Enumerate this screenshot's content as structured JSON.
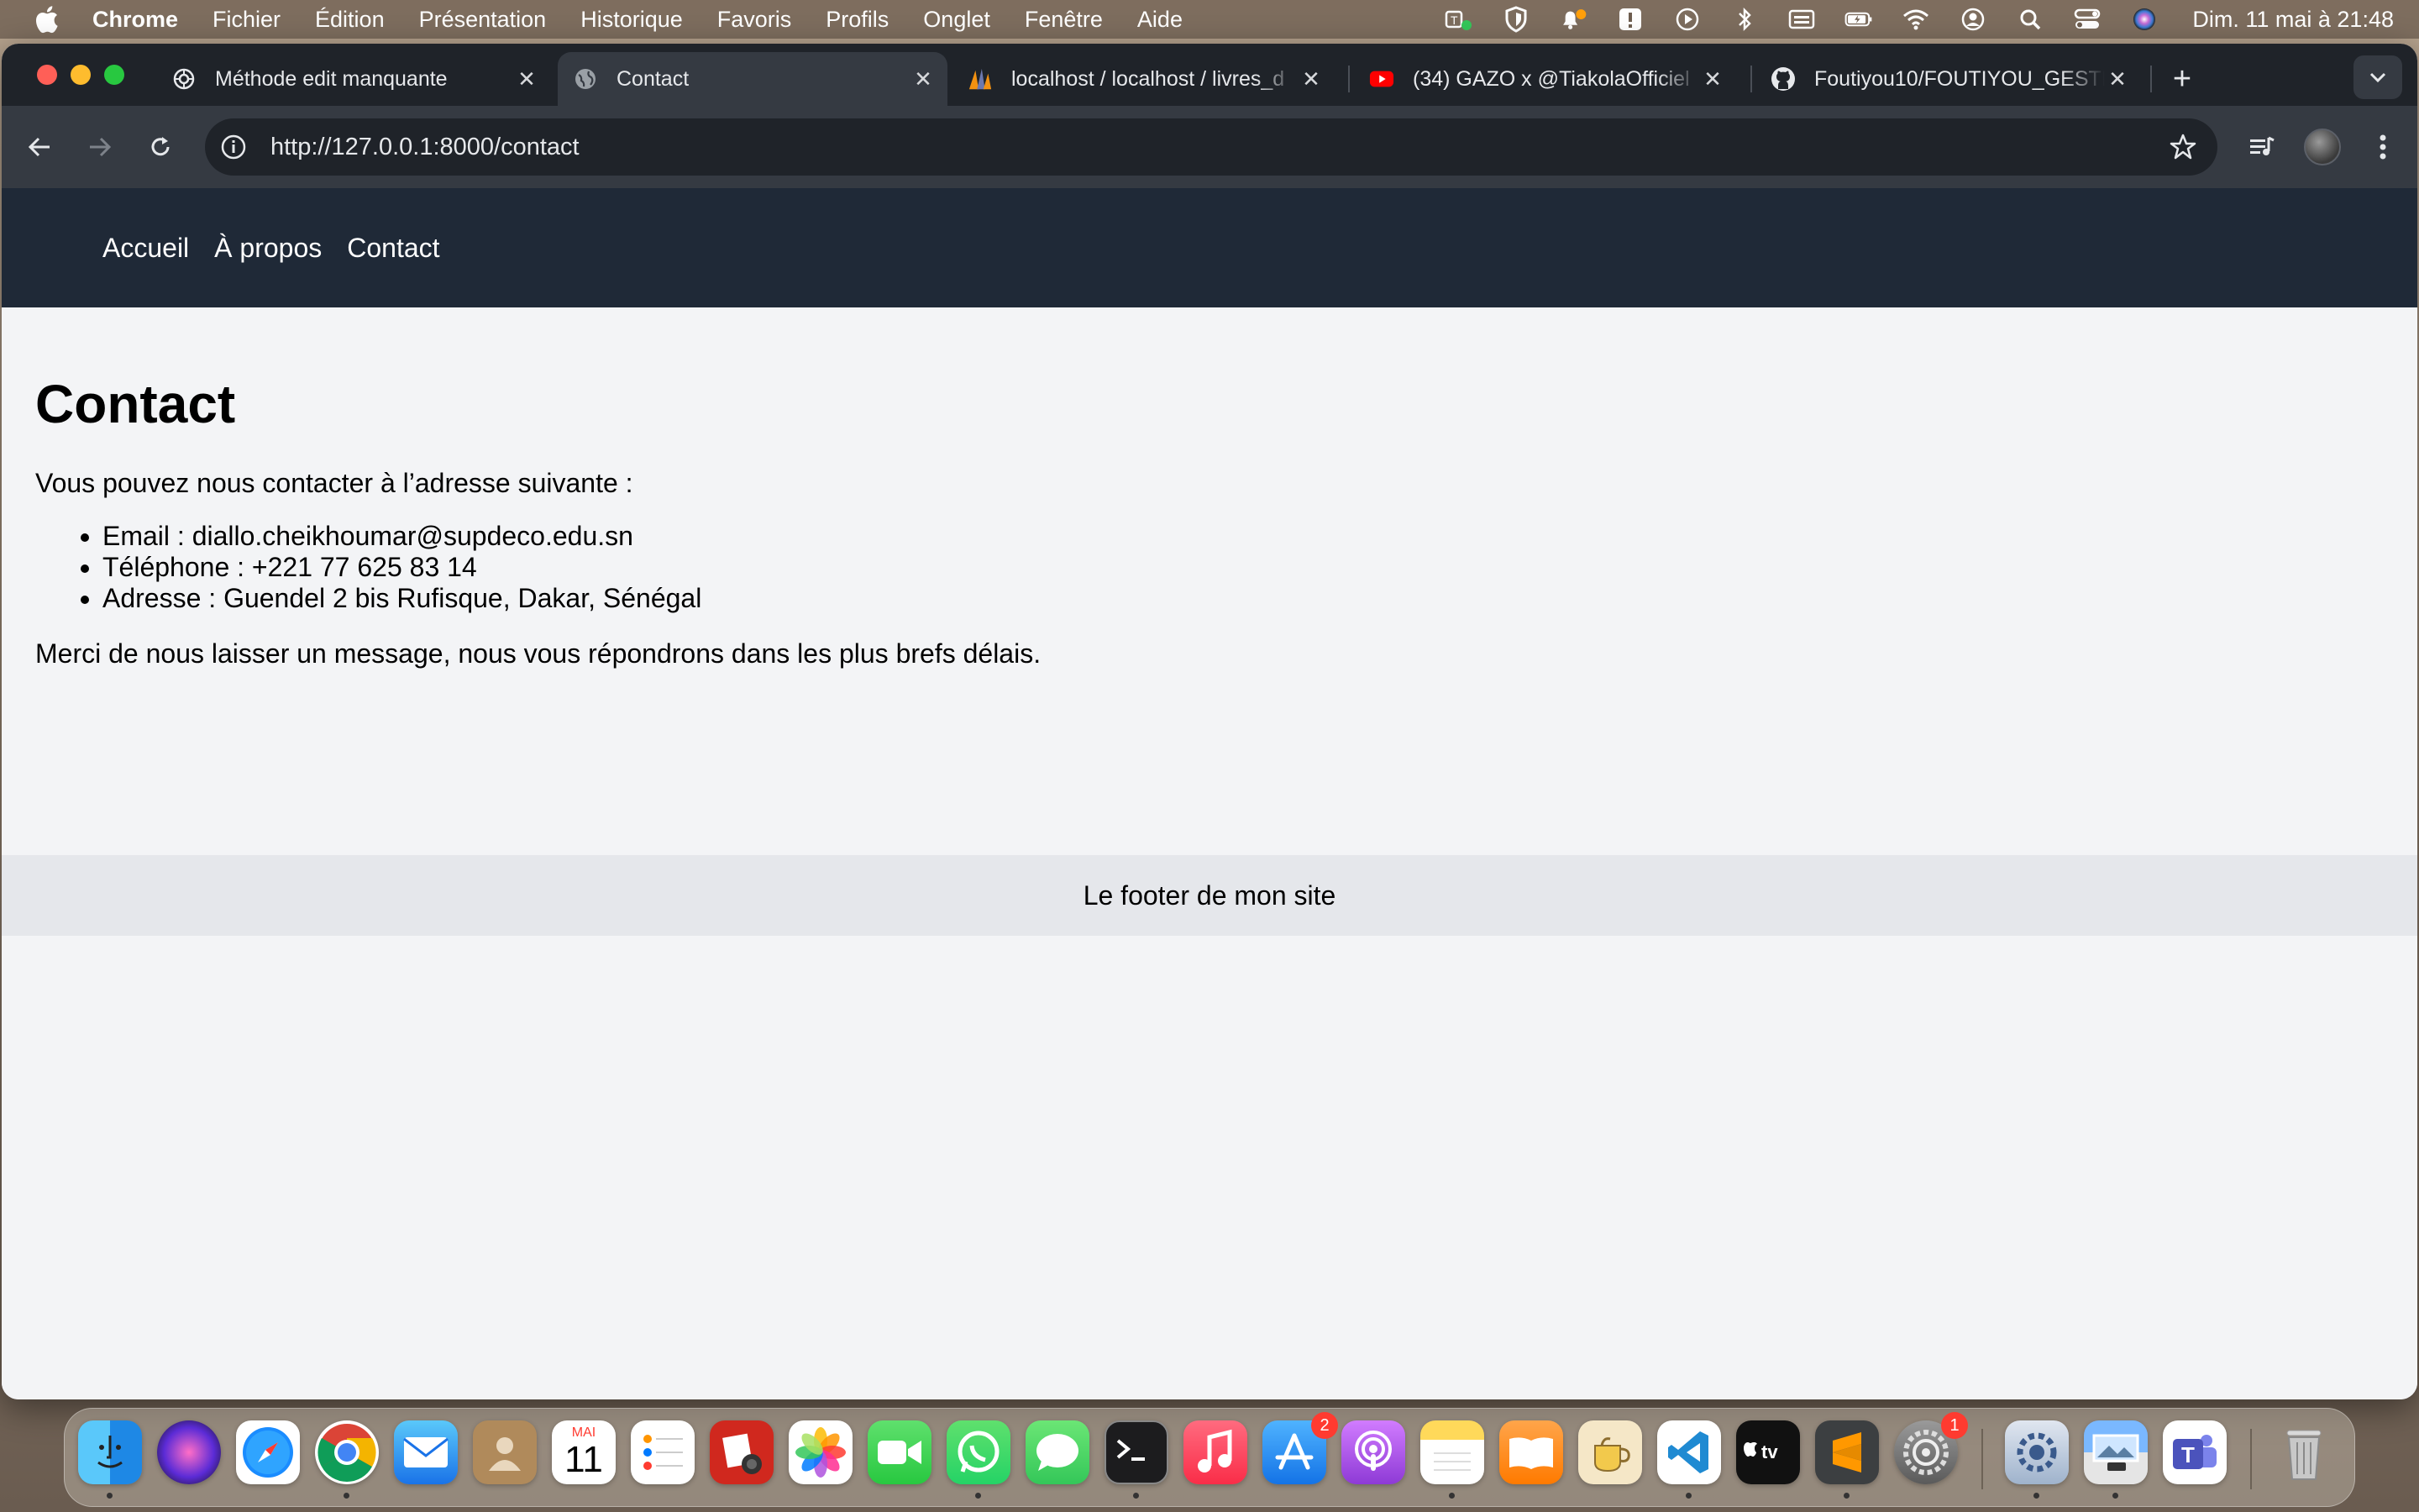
{
  "menubar": {
    "app_name": "Chrome",
    "items": [
      "Fichier",
      "Édition",
      "Présentation",
      "Historique",
      "Favoris",
      "Profils",
      "Onglet",
      "Fenêtre",
      "Aide"
    ],
    "clock": "Dim. 11 mai à  21:48",
    "status_icons": [
      "teams-status-icon",
      "vpn-shield-icon",
      "notification-bell-icon",
      "alert-icon",
      "play-icon",
      "bluetooth-icon",
      "keyboard-icon",
      "battery-icon",
      "wifi-icon",
      "user-icon",
      "spotlight-search-icon",
      "control-center-icon",
      "siri-icon"
    ]
  },
  "tabs": [
    {
      "title": "Méthode edit manquante",
      "icon": "chatgpt-icon",
      "active": false
    },
    {
      "title": "Contact",
      "icon": "globe-icon",
      "active": true
    },
    {
      "title": "localhost / localhost / livres_d",
      "icon": "phpmyadmin-icon",
      "active": false
    },
    {
      "title": "(34) GAZO x @TiakolaOfficiel",
      "icon": "youtube-icon",
      "active": false
    },
    {
      "title": "Foutiyou10/FOUTIYOU_GESTI",
      "icon": "github-icon",
      "active": false
    }
  ],
  "toolbar": {
    "url": "http://127.0.0.1:8000/contact"
  },
  "site": {
    "nav": [
      "Accueil",
      "À propos",
      "Contact"
    ],
    "title": "Contact",
    "intro": "Vous pouvez nous contacter à l’adresse suivante :",
    "list": [
      "Email : diallo.cheikhoumar@supdeco.edu.sn",
      "Téléphone : +221 77 625 83 14",
      "Adresse : Guendel 2 bis Rufisque, Dakar, Sénégal"
    ],
    "thanks": "Merci de nous laisser un message, nous vous répondrons dans les plus brefs délais.",
    "footer": "Le footer de mon site"
  },
  "dock": {
    "calendar_month": "MAI",
    "calendar_day": "11",
    "appstore_badge": "2",
    "settings_badge": "1",
    "apps": [
      "finder-icon",
      "siri-icon",
      "safari-icon",
      "chrome-icon",
      "mail-icon",
      "contacts-icon",
      "calendar-icon",
      "reminders-icon",
      "photo-booth-icon",
      "photos-icon",
      "facetime-icon",
      "whatsapp-icon",
      "messages-icon",
      "terminal-icon",
      "music-icon",
      "app-store-icon",
      "podcasts-icon",
      "notes-icon",
      "books-icon",
      "pyzo-icon",
      "vscode-icon",
      "apple-tv-icon",
      "sublime-text-icon",
      "system-settings-icon",
      "preferences-icon",
      "preview-icon",
      "teams-icon",
      "trash-icon"
    ]
  }
}
